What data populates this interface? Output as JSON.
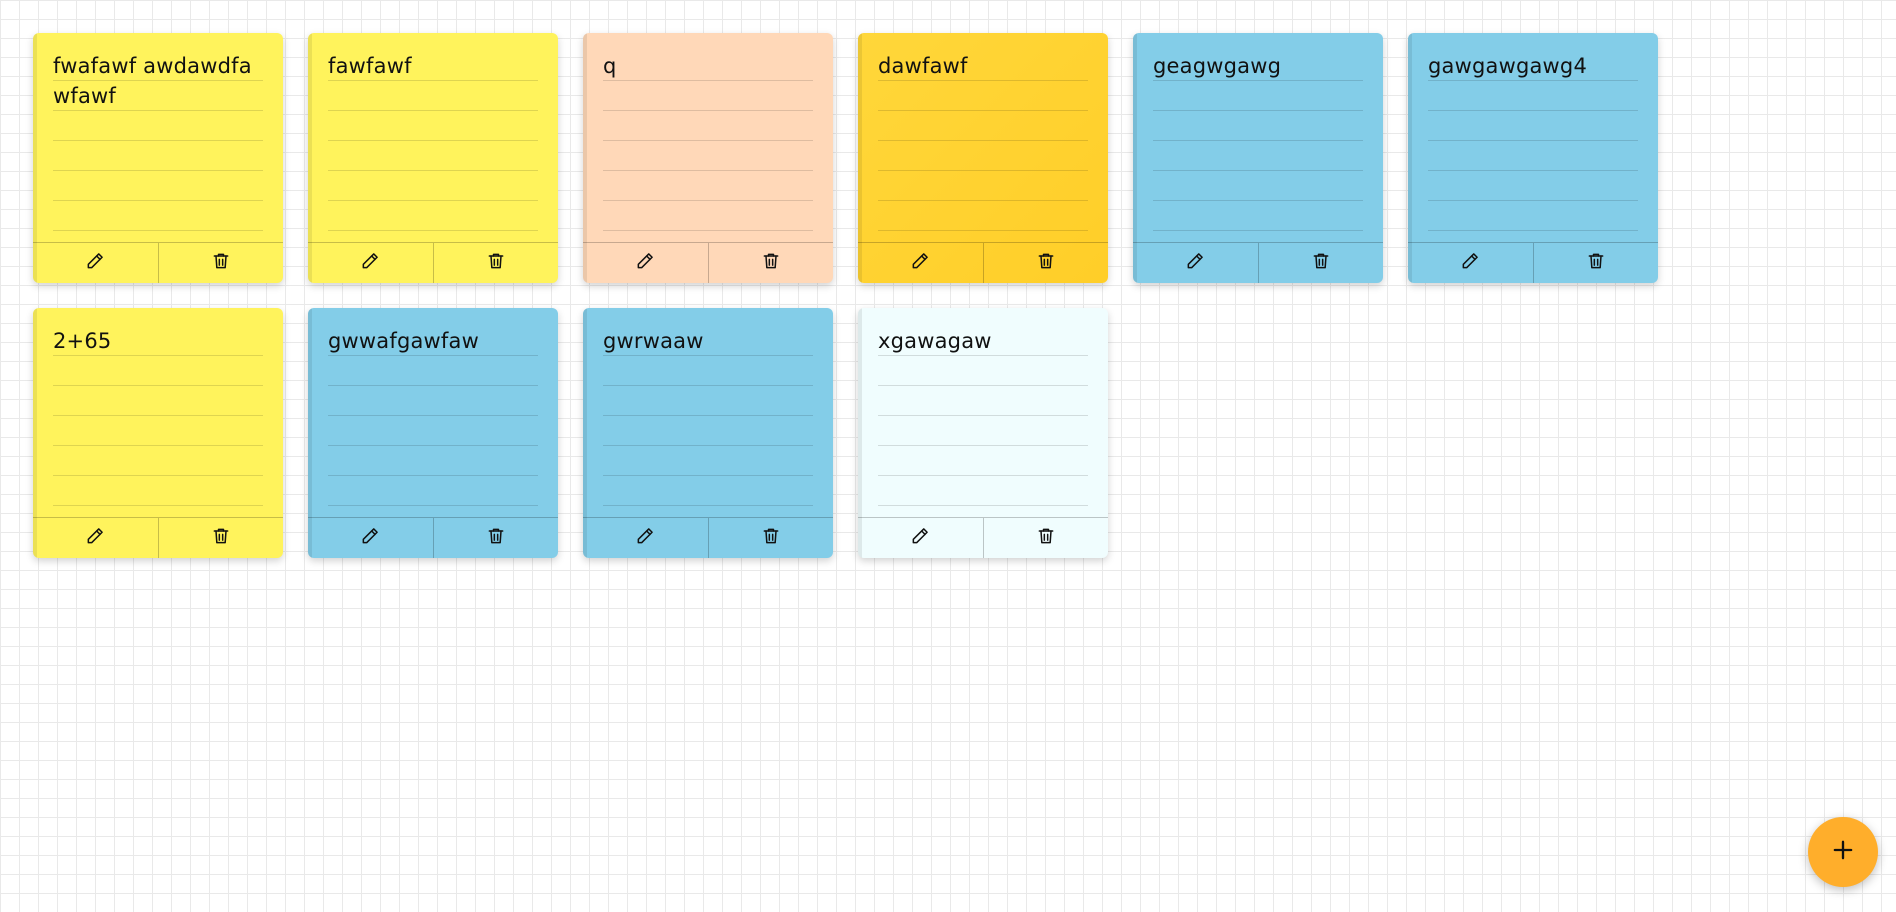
{
  "colors": {
    "yellow": "#fff35c",
    "peach": "#ffd8b8",
    "gold": "#ffd32c",
    "blue": "#83cde8",
    "mint": "#f0fdfe",
    "fab": "#ffae2b"
  },
  "notes": [
    {
      "text": "fwafawf awdawdfa wfawf",
      "color": "yellow"
    },
    {
      "text": "fawfawf",
      "color": "yellow"
    },
    {
      "text": "q",
      "color": "peach"
    },
    {
      "text": "dawfawf",
      "color": "gold"
    },
    {
      "text": "geagwgawg",
      "color": "blue"
    },
    {
      "text": "gawgawgawg4",
      "color": "blue"
    },
    {
      "text": "2+65",
      "color": "yellow"
    },
    {
      "text": "gwwafgawfaw",
      "color": "blue"
    },
    {
      "text": "gwrwaaw",
      "color": "blue"
    },
    {
      "text": "xgawagaw",
      "color": "mint"
    }
  ],
  "icons": {
    "edit": "pencil-icon",
    "delete": "trash-icon",
    "add": "plus-icon"
  }
}
